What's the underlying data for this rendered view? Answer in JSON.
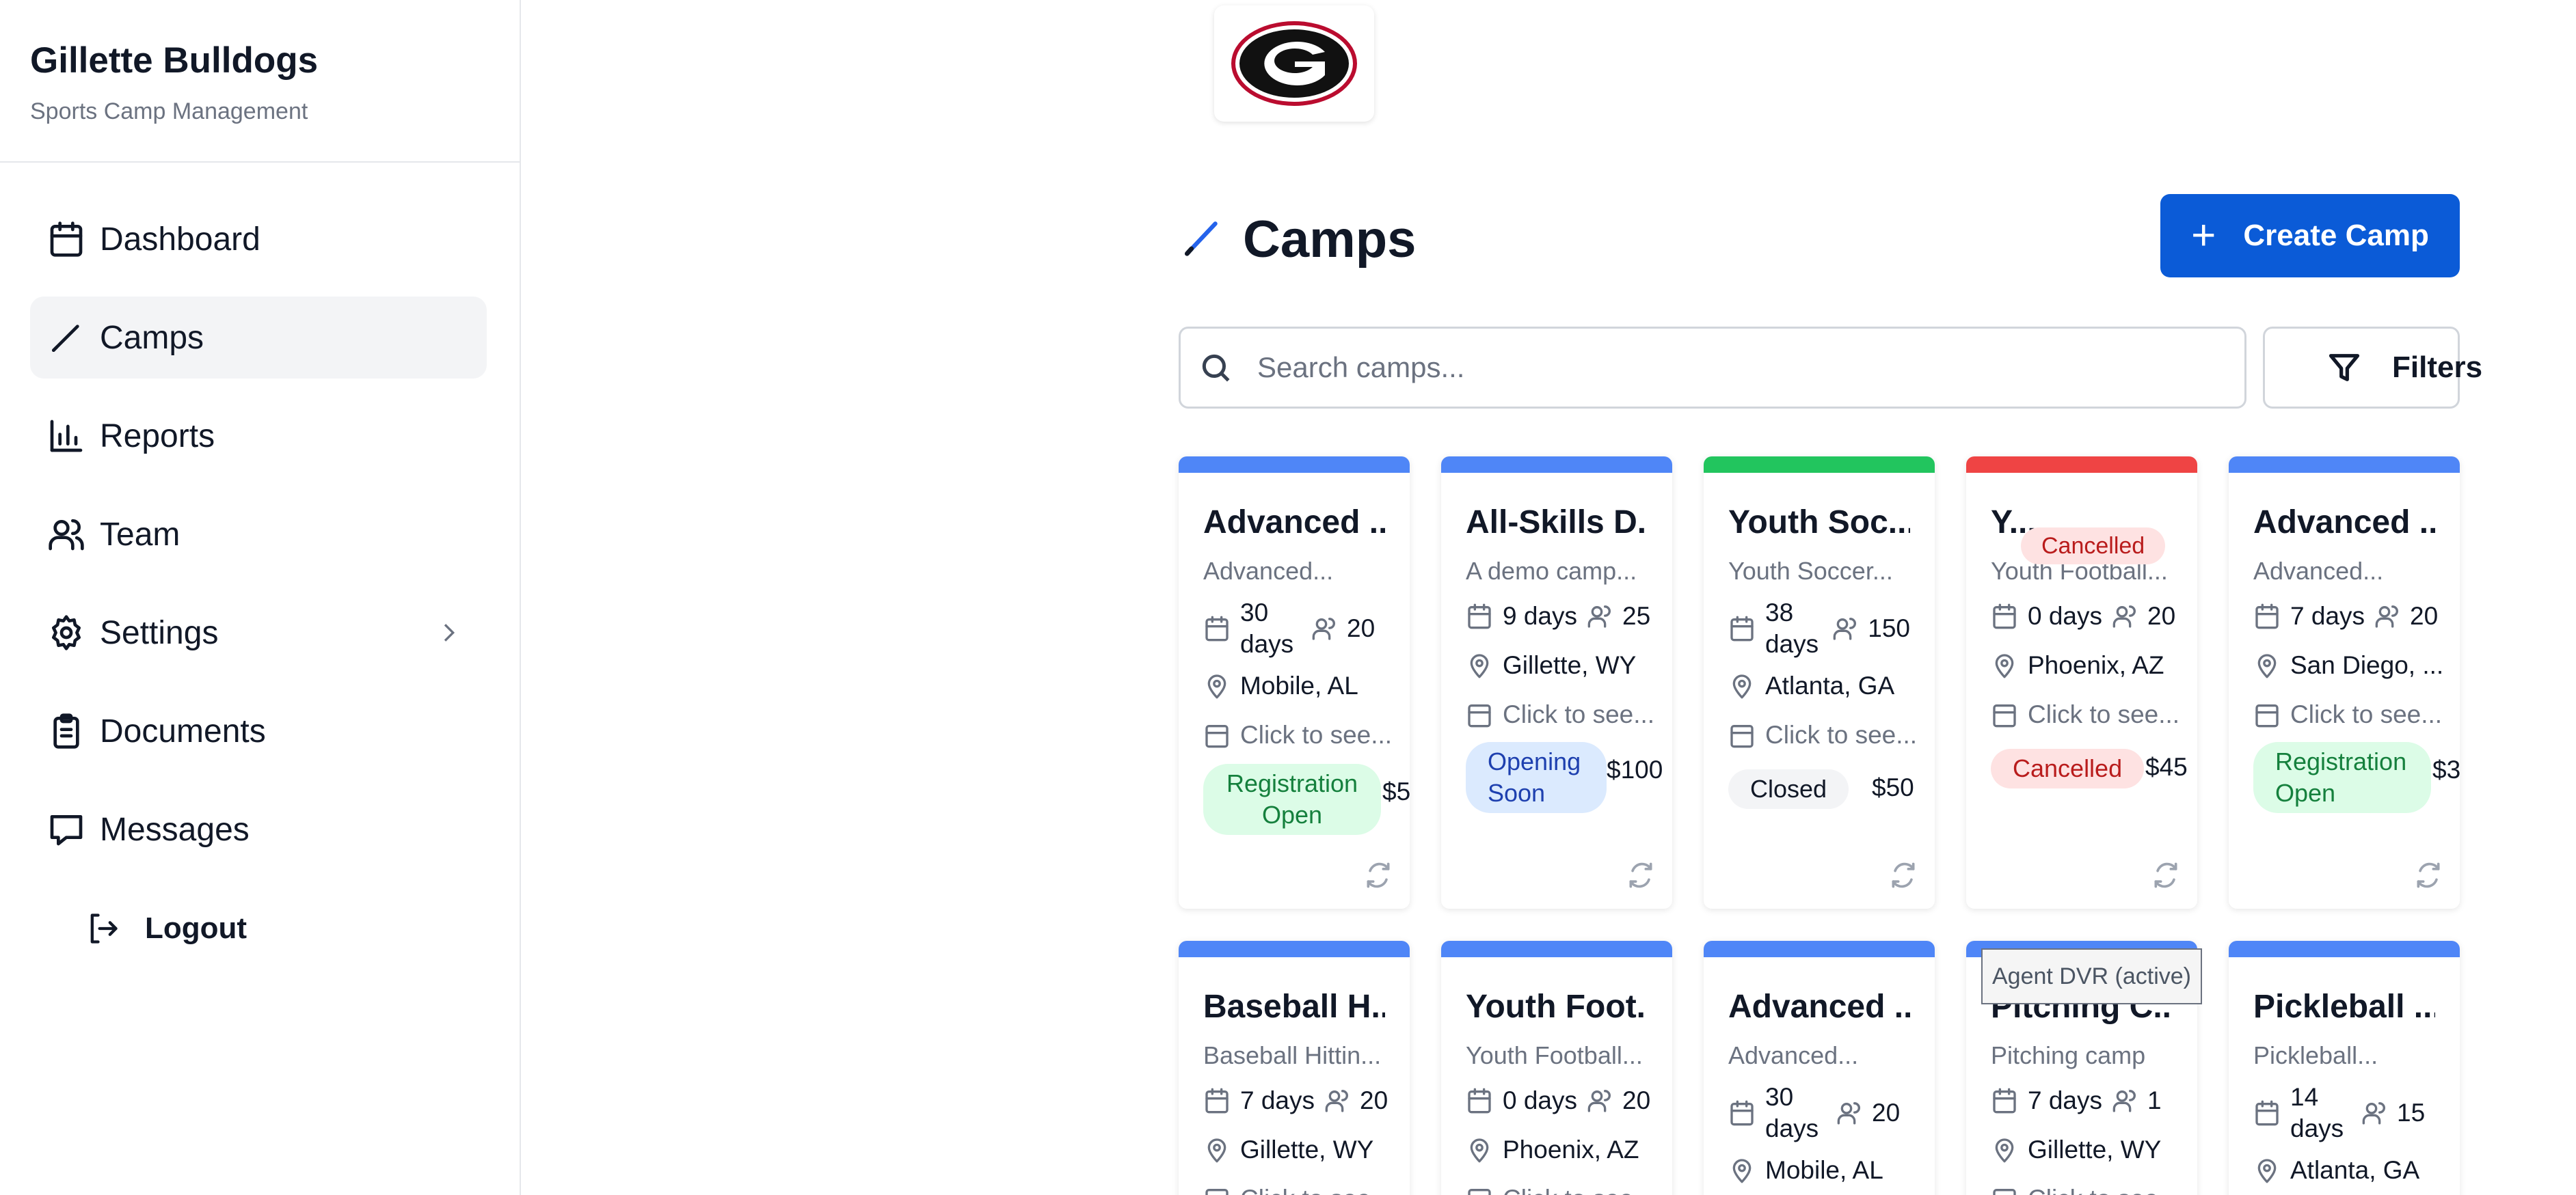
{
  "sidebar": {
    "brand_title": "Gillette Bulldogs",
    "brand_subtitle": "Sports Camp Management",
    "items": [
      {
        "label": "Dashboard",
        "icon": "calendar-icon"
      },
      {
        "label": "Camps",
        "icon": "pencil-icon",
        "active": true
      },
      {
        "label": "Reports",
        "icon": "bar-chart-icon"
      },
      {
        "label": "Team",
        "icon": "users-icon"
      },
      {
        "label": "Settings",
        "icon": "gear-icon"
      },
      {
        "label": "Documents",
        "icon": "clipboard-icon"
      },
      {
        "label": "Messages",
        "icon": "message-icon"
      }
    ],
    "logout_label": "Logout"
  },
  "header": {
    "title": "Camps",
    "create_label": "Create Camp",
    "search_placeholder": "Search camps...",
    "filters_label": "Filters"
  },
  "colors": {
    "accent": "#0b5bd7",
    "bar_blue": "#4f86f7",
    "bar_green": "#22c55e",
    "bar_red": "#ef4444"
  },
  "cards": [
    {
      "title": "Advanced ...",
      "desc": "Advanced...",
      "days": "30 days",
      "people": "20",
      "location": "Mobile, AL",
      "dates": "Click to see...",
      "status": "Registration Open",
      "price": "$5"
    },
    {
      "title": "All-Skills D...",
      "desc": "A demo camp...",
      "days": "9 days",
      "people": "25",
      "location": "Gillette, WY",
      "dates": "Click to see...",
      "status": "Opening Soon",
      "price": "$100"
    },
    {
      "title": "Youth Soc...",
      "desc": "Youth Soccer...",
      "days": "38 days",
      "people": "150",
      "location": "Atlanta, GA",
      "dates": "Click to see...",
      "status": "Closed",
      "price": "$50"
    },
    {
      "title": "Y...",
      "desc": "Youth Football...",
      "days": "0 days",
      "people": "20",
      "location": "Phoenix, AZ",
      "dates": "Click to see...",
      "status": "Cancelled",
      "price": "$45",
      "top_badge": "Cancelled"
    },
    {
      "title": "Advanced ...",
      "desc": "Advanced...",
      "days": "7 days",
      "people": "20",
      "location": "San Diego, ...",
      "dates": "Click to see...",
      "status": "Registration Open",
      "price": "$3"
    },
    {
      "title": "Baseball H...",
      "desc": "Baseball Hittin...",
      "days": "7 days",
      "people": "20",
      "location": "Gillette, WY",
      "dates": "Click to see..."
    },
    {
      "title": "Youth Foot...",
      "desc": "Youth Football...",
      "days": "0 days",
      "people": "20",
      "location": "Phoenix, AZ",
      "dates": "Click to see..."
    },
    {
      "title": "Advanced ...",
      "desc": "Advanced...",
      "days": "30 days",
      "people": "20",
      "location": "Mobile, AL"
    },
    {
      "title": "Pitching C...",
      "desc": "Pitching camp",
      "days": "7 days",
      "people": "1",
      "location": "Gillette, WY",
      "dates": "Click to see..."
    },
    {
      "title": "Pickleball ...",
      "desc": "Pickleball...",
      "days": "14 days",
      "people": "15",
      "location": "Atlanta, GA"
    }
  ],
  "tooltip": "Agent DVR (active)"
}
